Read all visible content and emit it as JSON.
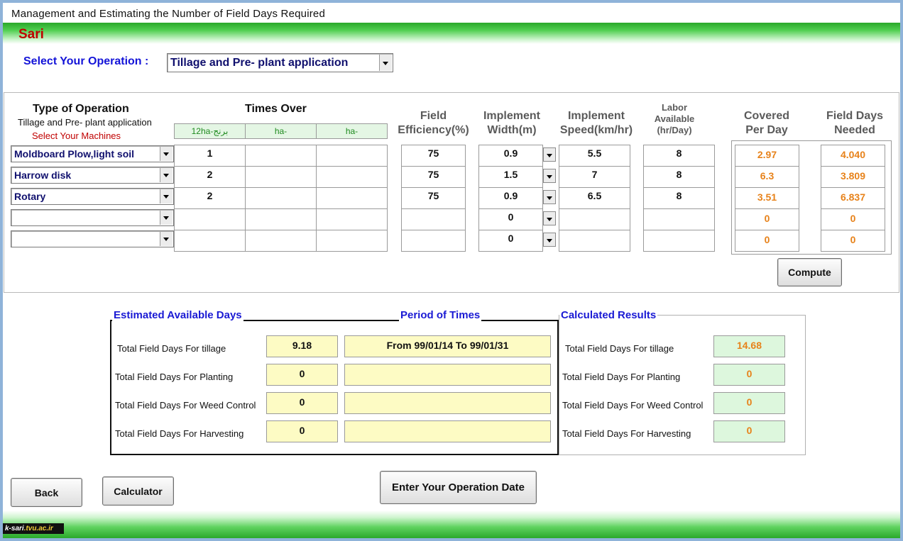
{
  "window": {
    "title": "Management and Estimating the Number of Field Days Required"
  },
  "header": {
    "city": "Sari"
  },
  "operation": {
    "label": "Select Your Operation :",
    "selected": "Tillage and Pre- plant application"
  },
  "table": {
    "type_title": "Type of Operation",
    "type_subtitle": "Tillage and Pre- plant application",
    "select_machines": "Select Your Machines",
    "times_over": "Times Over",
    "ha_headers": [
      "12ha-برنج",
      "ha-",
      "ha-"
    ],
    "col_field_eff": [
      "Field",
      "Efficiency(%)"
    ],
    "col_impl_width": [
      "Implement",
      "Width(m)"
    ],
    "col_impl_speed": [
      "Implement",
      "Speed(km/hr)"
    ],
    "col_labor": [
      "Labor",
      "Available",
      "(hr/Day)"
    ],
    "col_covered": [
      "Covered",
      "Per Day"
    ],
    "col_fielddays": [
      "Field Days",
      "Needed"
    ],
    "rows": [
      {
        "machine": "Moldboard Plow,light soil",
        "t1": "1",
        "t2": "",
        "t3": "",
        "eff": "75",
        "width": "0.9",
        "speed": "5.5",
        "labor": "8",
        "covered": "2.97",
        "days": "4.040"
      },
      {
        "machine": "Harrow disk",
        "t1": "2",
        "t2": "",
        "t3": "",
        "eff": "75",
        "width": "1.5",
        "speed": "7",
        "labor": "8",
        "covered": "6.3",
        "days": "3.809"
      },
      {
        "machine": "Rotary",
        "t1": "2",
        "t2": "",
        "t3": "",
        "eff": "75",
        "width": "0.9",
        "speed": "6.5",
        "labor": "8",
        "covered": "3.51",
        "days": "6.837"
      },
      {
        "machine": "",
        "t1": "",
        "t2": "",
        "t3": "",
        "eff": "",
        "width": "0",
        "speed": "",
        "labor": "",
        "covered": "0",
        "days": "0"
      },
      {
        "machine": "",
        "t1": "",
        "t2": "",
        "t3": "",
        "eff": "",
        "width": "0",
        "speed": "",
        "labor": "",
        "covered": "0",
        "days": "0"
      }
    ],
    "compute": "Compute"
  },
  "estimated": {
    "title": "Estimated Available Days",
    "period_title": "Period  of  Times",
    "items": [
      {
        "label": "Total Field Days For tillage",
        "value": "9.18",
        "period": "From  99/01/14  To  99/01/31"
      },
      {
        "label": "Total Field Days For Planting",
        "value": "0",
        "period": ""
      },
      {
        "label": "Total Field Days For Weed Control",
        "value": "0",
        "period": ""
      },
      {
        "label": "Total Field Days For Harvesting",
        "value": "0",
        "period": ""
      }
    ]
  },
  "results": {
    "title": "Calculated Results",
    "items": [
      {
        "label": "Total Field Days For tillage",
        "value": "14.68"
      },
      {
        "label": "Total Field Days For Planting",
        "value": "0"
      },
      {
        "label": "Total Field Days For Weed Control",
        "value": "0"
      },
      {
        "label": "Total Field Days For Harvesting",
        "value": "0"
      }
    ]
  },
  "buttons": {
    "back": "Back",
    "calculator": "Calculator",
    "enter_date": "Enter Your Operation Date"
  },
  "footer": {
    "logo_a": "k-sari",
    "logo_b": ".tvu.ac.ir"
  }
}
